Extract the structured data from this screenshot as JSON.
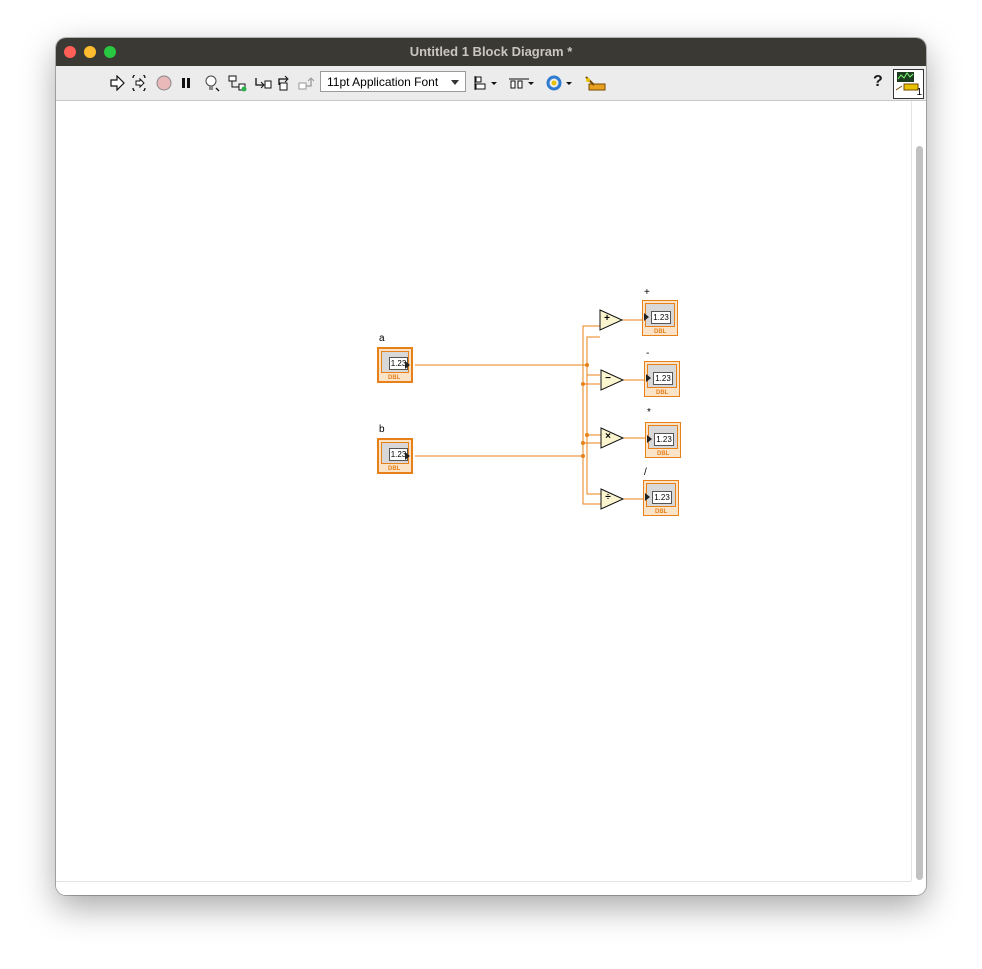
{
  "window": {
    "title": "Untitled 1 Block Diagram *"
  },
  "toolbar": {
    "font_select": "11pt Application Font",
    "help": "?",
    "connector_pane_number": "1",
    "icons": [
      "run-icon",
      "run-continuously-icon",
      "abort-icon",
      "pause-icon",
      "highlight-execution-icon",
      "retain-wire-values-icon",
      "step-into-icon",
      "step-over-icon",
      "step-out-icon",
      "align-objects-icon",
      "distribute-objects-icon",
      "reorder-icon",
      "clean-up-diagram-icon"
    ]
  },
  "diagram": {
    "controls": [
      {
        "label": "a",
        "value": "1.23",
        "type": "DBL"
      },
      {
        "label": "b",
        "value": "1.23",
        "type": "DBL"
      }
    ],
    "operators": [
      "+",
      "−",
      "×",
      "÷"
    ],
    "indicators": [
      {
        "label": "+",
        "value": "1.23",
        "type": "DBL"
      },
      {
        "label": "-",
        "value": "1.23",
        "type": "DBL"
      },
      {
        "label": "*",
        "value": "1.23",
        "type": "DBL"
      },
      {
        "label": "/",
        "value": "1.23",
        "type": "DBL"
      }
    ],
    "wire_color": "#e8801a",
    "node_fill": "#fbf5cf"
  }
}
